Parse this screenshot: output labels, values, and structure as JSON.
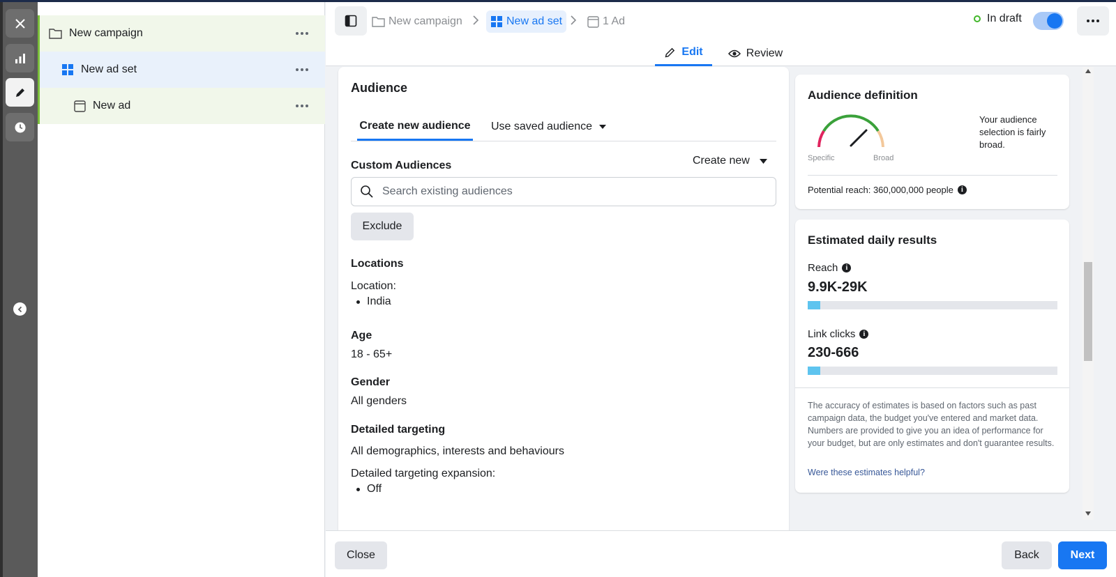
{
  "tree": {
    "campaign": "New campaign",
    "adset": "New ad set",
    "ad": "New ad"
  },
  "header": {
    "breadcrumb": {
      "campaign": "New campaign",
      "adset": "New ad set",
      "ad": "1 Ad"
    },
    "status": "In draft",
    "tabs": {
      "edit": "Edit",
      "review": "Review"
    }
  },
  "audience": {
    "title": "Audience",
    "tab_new": "Create new audience",
    "tab_saved": "Use saved audience",
    "custom_label": "Custom Audiences",
    "create_new": "Create new",
    "search_placeholder": "Search existing audiences",
    "exclude": "Exclude",
    "locations_label": "Locations",
    "location_sub": "Location:",
    "location_value": "India",
    "age_label": "Age",
    "age_value": "18 - 65+",
    "gender_label": "Gender",
    "gender_value": "All genders",
    "detailed_label": "Detailed targeting",
    "detailed_value": "All demographics, interests and behaviours",
    "expansion_label": "Detailed targeting expansion:",
    "expansion_value": "Off"
  },
  "definition": {
    "title": "Audience definition",
    "gauge_specific": "Specific",
    "gauge_broad": "Broad",
    "message": "Your audience selection is fairly broad.",
    "potential_reach": "Potential reach: 360,000,000 people"
  },
  "estimates": {
    "title": "Estimated daily results",
    "reach_label": "Reach",
    "reach_value": "9.9K-29K",
    "reach_fill": 0.05,
    "clicks_label": "Link clicks",
    "clicks_value": "230-666",
    "clicks_fill": 0.05,
    "disclaimer": "The accuracy of estimates is based on factors such as past campaign data, the budget you've entered and market data. Numbers are provided to give you an idea of performance for your budget, but are only estimates and don't guarantee results.",
    "helpful_link": "Were these estimates helpful?"
  },
  "footer": {
    "close": "Close",
    "back": "Back",
    "next": "Next"
  },
  "colors": {
    "accent": "#1877f2",
    "draft_green": "#42b72a",
    "estimate_bar": "#5ec4ef"
  }
}
